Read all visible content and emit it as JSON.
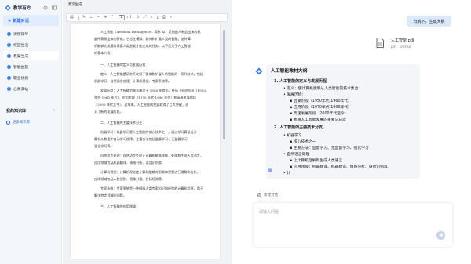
{
  "sidebar": {
    "brand": "教学有方",
    "new_chat": "+ 新建对话",
    "items": [
      {
        "label": "课程辅导",
        "color": "#3a7cf5"
      },
      {
        "label": "校园生活",
        "color": "#3a7cf5"
      },
      {
        "label": "教案生成",
        "color": "#3a7cf5"
      },
      {
        "label": "智能出题",
        "color": "#3a7cf5"
      },
      {
        "label": "职业规划",
        "color": "#3a7cf5"
      },
      {
        "label": "心灵驿站",
        "color": "#3a7cf5"
      }
    ],
    "my_kb": "我的知识库",
    "more_kb": "更多知识库"
  },
  "document": {
    "tab": "教案生成",
    "page_current": "1",
    "page_total": "/ 2",
    "lines": [
      "人工智能（Artificial Intelligence，简称 AI）是指由人制造出来的机",
      "器所表现出来的智能。它旨在模拟、延伸和扩展人类的智能，使计算",
      "机能够完成通常需要人类智能才能完成的任务，以下是关于人工智能",
      "的基本介绍：",
      "一、人工智能的定义与发展历程",
      "定义：人工智能是研究开发用于模拟和扩展人的智能的一系列技术。包括",
      "机器学习、自然语言处理、计算机视觉、专家系统等。",
      "发展历程：人工智能的概念最早于 1956 年提出，经历了初创阶段（1950",
      "年代-1960 年代）、应用阶段（1970 年代-1990 年代）和高速发展阶段",
      "（2000 年代至今）。近年来，人工智能的发展取得了巨大突破，进",
      "入了新的发展阶段。",
      "二、人工智能的主要技术分支",
      "机器学习：机器学习是人工智能的核心技术之一，通过学习算法让计",
      "算机从数据中自动学习规律。主要方法包括监督学习、无监督学习、",
      "强化学习等。",
      "自然语言处理：自然语言处理让计算机能够理解、处理和生成人类语言，",
      "应用领域包括机器翻译、情感分析、语音识别等。",
      "计算机视觉：计算机视觉使计算机能够对图像和视频进行理解和分析，",
      "应用领域包括人脸识别、图像分割、目标检测等。",
      "专家系统：专家系统是一种模拟人类专家知识和经验的计算机程序，用于",
      "解决特定领域的问题。",
      "三、人工智能的应用领域"
    ]
  },
  "chat": {
    "user_message": "归纳下，生成大纲",
    "file_name": "人工智能.pdf",
    "file_type": "pdf",
    "file_size": "204KB",
    "answer": {
      "title": "人工智能教材大纲",
      "section1": "1. 人工智能的定义与发展历程",
      "s1_items": [
        "定义：使计算机能够从人类智能的技术集合",
        "发展历程：",
        "启蒙阶段（1950年代-1960年代）",
        "应用阶段（1970年代-1990年代）",
        "高速发展阶段（2000年代至今）",
        "我国人工智能发展的重要与成就"
      ],
      "section2": "2. 人工智能的主要技术分支",
      "s2_items": [
        "机器学习",
        "核心技术之一",
        "主要方法：监督学习、无监督学习、强化学习",
        "自然语言处理",
        "让计算机理解和生成人类语言",
        "应用领域：机器翻译、机器翻译、情感分析、语音识别等",
        "计"
      ],
      "badge": "回"
    },
    "new_chat": "新建对话",
    "input_placeholder": "请输入问题"
  }
}
